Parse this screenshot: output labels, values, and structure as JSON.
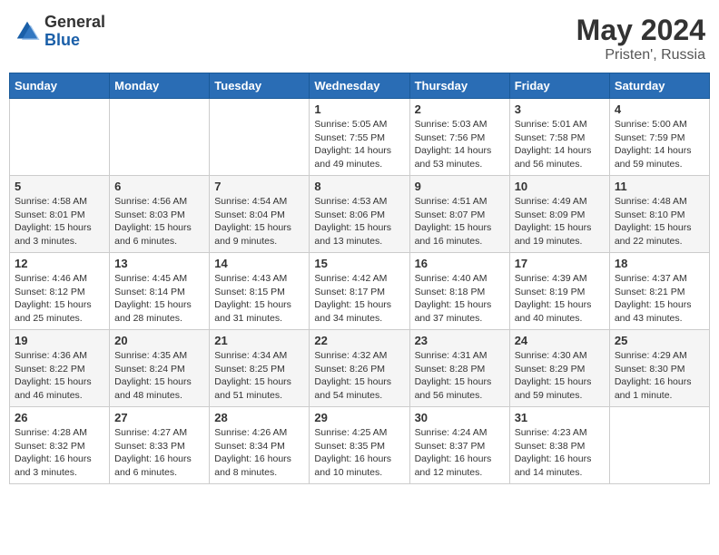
{
  "header": {
    "logo_general": "General",
    "logo_blue": "Blue",
    "month_year": "May 2024",
    "location": "Pristen', Russia"
  },
  "weekdays": [
    "Sunday",
    "Monday",
    "Tuesday",
    "Wednesday",
    "Thursday",
    "Friday",
    "Saturday"
  ],
  "weeks": [
    [
      {
        "day": "",
        "sunrise": "",
        "sunset": "",
        "daylight": ""
      },
      {
        "day": "",
        "sunrise": "",
        "sunset": "",
        "daylight": ""
      },
      {
        "day": "",
        "sunrise": "",
        "sunset": "",
        "daylight": ""
      },
      {
        "day": "1",
        "sunrise": "Sunrise: 5:05 AM",
        "sunset": "Sunset: 7:55 PM",
        "daylight": "Daylight: 14 hours and 49 minutes."
      },
      {
        "day": "2",
        "sunrise": "Sunrise: 5:03 AM",
        "sunset": "Sunset: 7:56 PM",
        "daylight": "Daylight: 14 hours and 53 minutes."
      },
      {
        "day": "3",
        "sunrise": "Sunrise: 5:01 AM",
        "sunset": "Sunset: 7:58 PM",
        "daylight": "Daylight: 14 hours and 56 minutes."
      },
      {
        "day": "4",
        "sunrise": "Sunrise: 5:00 AM",
        "sunset": "Sunset: 7:59 PM",
        "daylight": "Daylight: 14 hours and 59 minutes."
      }
    ],
    [
      {
        "day": "5",
        "sunrise": "Sunrise: 4:58 AM",
        "sunset": "Sunset: 8:01 PM",
        "daylight": "Daylight: 15 hours and 3 minutes."
      },
      {
        "day": "6",
        "sunrise": "Sunrise: 4:56 AM",
        "sunset": "Sunset: 8:03 PM",
        "daylight": "Daylight: 15 hours and 6 minutes."
      },
      {
        "day": "7",
        "sunrise": "Sunrise: 4:54 AM",
        "sunset": "Sunset: 8:04 PM",
        "daylight": "Daylight: 15 hours and 9 minutes."
      },
      {
        "day": "8",
        "sunrise": "Sunrise: 4:53 AM",
        "sunset": "Sunset: 8:06 PM",
        "daylight": "Daylight: 15 hours and 13 minutes."
      },
      {
        "day": "9",
        "sunrise": "Sunrise: 4:51 AM",
        "sunset": "Sunset: 8:07 PM",
        "daylight": "Daylight: 15 hours and 16 minutes."
      },
      {
        "day": "10",
        "sunrise": "Sunrise: 4:49 AM",
        "sunset": "Sunset: 8:09 PM",
        "daylight": "Daylight: 15 hours and 19 minutes."
      },
      {
        "day": "11",
        "sunrise": "Sunrise: 4:48 AM",
        "sunset": "Sunset: 8:10 PM",
        "daylight": "Daylight: 15 hours and 22 minutes."
      }
    ],
    [
      {
        "day": "12",
        "sunrise": "Sunrise: 4:46 AM",
        "sunset": "Sunset: 8:12 PM",
        "daylight": "Daylight: 15 hours and 25 minutes."
      },
      {
        "day": "13",
        "sunrise": "Sunrise: 4:45 AM",
        "sunset": "Sunset: 8:14 PM",
        "daylight": "Daylight: 15 hours and 28 minutes."
      },
      {
        "day": "14",
        "sunrise": "Sunrise: 4:43 AM",
        "sunset": "Sunset: 8:15 PM",
        "daylight": "Daylight: 15 hours and 31 minutes."
      },
      {
        "day": "15",
        "sunrise": "Sunrise: 4:42 AM",
        "sunset": "Sunset: 8:17 PM",
        "daylight": "Daylight: 15 hours and 34 minutes."
      },
      {
        "day": "16",
        "sunrise": "Sunrise: 4:40 AM",
        "sunset": "Sunset: 8:18 PM",
        "daylight": "Daylight: 15 hours and 37 minutes."
      },
      {
        "day": "17",
        "sunrise": "Sunrise: 4:39 AM",
        "sunset": "Sunset: 8:19 PM",
        "daylight": "Daylight: 15 hours and 40 minutes."
      },
      {
        "day": "18",
        "sunrise": "Sunrise: 4:37 AM",
        "sunset": "Sunset: 8:21 PM",
        "daylight": "Daylight: 15 hours and 43 minutes."
      }
    ],
    [
      {
        "day": "19",
        "sunrise": "Sunrise: 4:36 AM",
        "sunset": "Sunset: 8:22 PM",
        "daylight": "Daylight: 15 hours and 46 minutes."
      },
      {
        "day": "20",
        "sunrise": "Sunrise: 4:35 AM",
        "sunset": "Sunset: 8:24 PM",
        "daylight": "Daylight: 15 hours and 48 minutes."
      },
      {
        "day": "21",
        "sunrise": "Sunrise: 4:34 AM",
        "sunset": "Sunset: 8:25 PM",
        "daylight": "Daylight: 15 hours and 51 minutes."
      },
      {
        "day": "22",
        "sunrise": "Sunrise: 4:32 AM",
        "sunset": "Sunset: 8:26 PM",
        "daylight": "Daylight: 15 hours and 54 minutes."
      },
      {
        "day": "23",
        "sunrise": "Sunrise: 4:31 AM",
        "sunset": "Sunset: 8:28 PM",
        "daylight": "Daylight: 15 hours and 56 minutes."
      },
      {
        "day": "24",
        "sunrise": "Sunrise: 4:30 AM",
        "sunset": "Sunset: 8:29 PM",
        "daylight": "Daylight: 15 hours and 59 minutes."
      },
      {
        "day": "25",
        "sunrise": "Sunrise: 4:29 AM",
        "sunset": "Sunset: 8:30 PM",
        "daylight": "Daylight: 16 hours and 1 minute."
      }
    ],
    [
      {
        "day": "26",
        "sunrise": "Sunrise: 4:28 AM",
        "sunset": "Sunset: 8:32 PM",
        "daylight": "Daylight: 16 hours and 3 minutes."
      },
      {
        "day": "27",
        "sunrise": "Sunrise: 4:27 AM",
        "sunset": "Sunset: 8:33 PM",
        "daylight": "Daylight: 16 hours and 6 minutes."
      },
      {
        "day": "28",
        "sunrise": "Sunrise: 4:26 AM",
        "sunset": "Sunset: 8:34 PM",
        "daylight": "Daylight: 16 hours and 8 minutes."
      },
      {
        "day": "29",
        "sunrise": "Sunrise: 4:25 AM",
        "sunset": "Sunset: 8:35 PM",
        "daylight": "Daylight: 16 hours and 10 minutes."
      },
      {
        "day": "30",
        "sunrise": "Sunrise: 4:24 AM",
        "sunset": "Sunset: 8:37 PM",
        "daylight": "Daylight: 16 hours and 12 minutes."
      },
      {
        "day": "31",
        "sunrise": "Sunrise: 4:23 AM",
        "sunset": "Sunset: 8:38 PM",
        "daylight": "Daylight: 16 hours and 14 minutes."
      },
      {
        "day": "",
        "sunrise": "",
        "sunset": "",
        "daylight": ""
      }
    ]
  ]
}
